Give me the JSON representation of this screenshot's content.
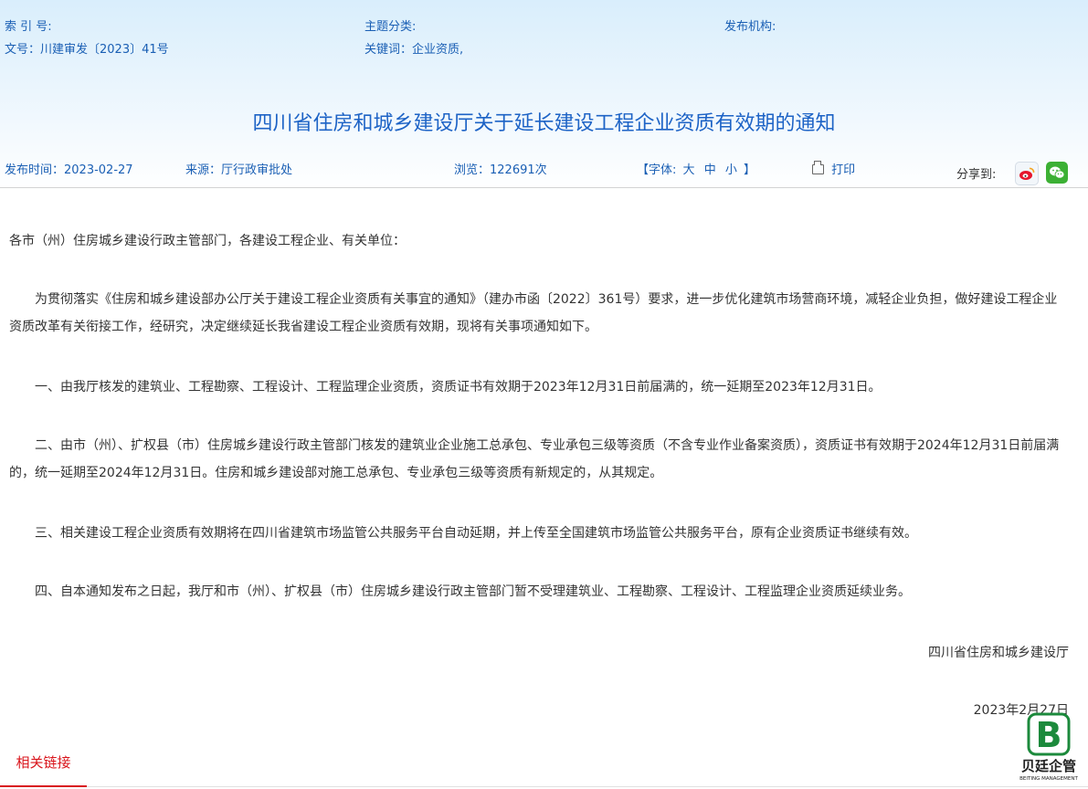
{
  "meta": {
    "index_label": "索 引 号:",
    "doc_no": "文号：川建审发〔2023〕41号",
    "topic_label": "主题分类:",
    "keywords": "关键词：企业资质,",
    "publisher_label": "发布机构:"
  },
  "title": "四川省住房和城乡建设厅关于延长建设工程企业资质有效期的通知",
  "info": {
    "publish_time": "发布时间：2023-02-27",
    "source": "来源：厅行政审批处",
    "views": "浏览：122691次",
    "font_open": "【字体:",
    "font_large": "大",
    "font_medium": "中",
    "font_small": "小",
    "font_close": "】",
    "print": "打印",
    "share_label": "分享到:"
  },
  "body": {
    "salutation": "各市（州）住房城乡建设行政主管部门，各建设工程企业、有关单位：",
    "p1": "为贯彻落实《住房和城乡建设部办公厅关于建设工程企业资质有关事宜的通知》（建办市函〔2022〕361号）要求，进一步优化建筑市场营商环境，减轻企业负担，做好建设工程企业资质改革有关衔接工作，经研究，决定继续延长我省建设工程企业资质有效期，现将有关事项通知如下。",
    "p2": "一、由我厅核发的建筑业、工程勘察、工程设计、工程监理企业资质，资质证书有效期于2023年12月31日前届满的，统一延期至2023年12月31日。",
    "p3": "二、由市（州）、扩权县（市）住房城乡建设行政主管部门核发的建筑业企业施工总承包、专业承包三级等资质（不含专业作业备案资质），资质证书有效期于2024年12月31日前届满的，统一延期至2024年12月31日。住房和城乡建设部对施工总承包、专业承包三级等资质有新规定的，从其规定。",
    "p4": "三、相关建设工程企业资质有效期将在四川省建筑市场监管公共服务平台自动延期，并上传至全国建筑市场监管公共服务平台，原有企业资质证书继续有效。",
    "p5": "四、自本通知发布之日起，我厅和市（州）、扩权县（市）住房城乡建设行政主管部门暂不受理建筑业、工程勘察、工程设计、工程监理企业资质延续业务。",
    "signature": "四川省住房和城乡建设厅",
    "date": "2023年2月27日"
  },
  "related": {
    "tab_label": "相关链接"
  },
  "watermark": {
    "text": "贝廷企管",
    "sub": "BEITING MANAGEMENT",
    "color": "#1c8a3c"
  },
  "colors": {
    "link_blue": "#1a5fb4",
    "title_blue": "#1d63c6",
    "accent_red": "#d9141b"
  }
}
